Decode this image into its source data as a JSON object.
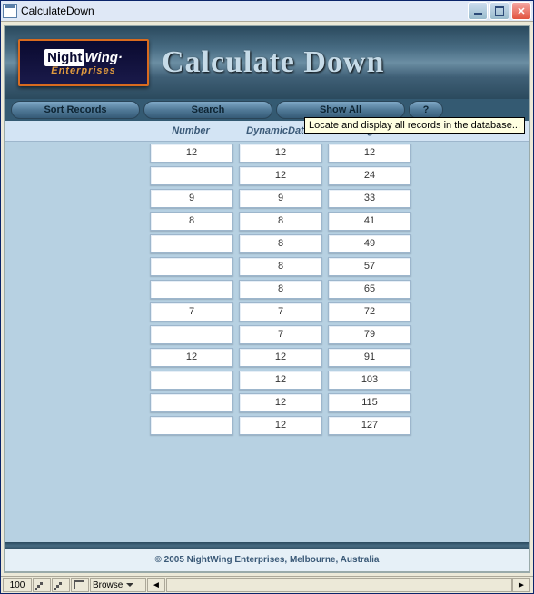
{
  "window": {
    "title": "CalculateDown"
  },
  "logo": {
    "part1": "Night",
    "part2": "Wing",
    "dot": "·",
    "sub": "Enterprises"
  },
  "banner": {
    "title": "Calculate Down"
  },
  "toolbar": {
    "sort": "Sort Records",
    "search": "Search",
    "showall": "Show All",
    "help": "?",
    "tooltip": "Locate and display all records in the database..."
  },
  "columns": {
    "number": "Number",
    "dynamic": "DynamicData",
    "running": "RunningTotal"
  },
  "rows": [
    {
      "n": "12",
      "d": "12",
      "r": "12"
    },
    {
      "n": "",
      "d": "12",
      "r": "24"
    },
    {
      "n": "9",
      "d": "9",
      "r": "33"
    },
    {
      "n": "8",
      "d": "8",
      "r": "41"
    },
    {
      "n": "",
      "d": "8",
      "r": "49"
    },
    {
      "n": "",
      "d": "8",
      "r": "57"
    },
    {
      "n": "",
      "d": "8",
      "r": "65"
    },
    {
      "n": "7",
      "d": "7",
      "r": "72"
    },
    {
      "n": "",
      "d": "7",
      "r": "79"
    },
    {
      "n": "12",
      "d": "12",
      "r": "91"
    },
    {
      "n": "",
      "d": "12",
      "r": "103"
    },
    {
      "n": "",
      "d": "12",
      "r": "115"
    },
    {
      "n": "",
      "d": "12",
      "r": "127"
    }
  ],
  "footer": {
    "copyright": "© 2005 NightWing Enterprises, Melbourne, Australia"
  },
  "status": {
    "zoom": "100",
    "mode": "Browse",
    "scroll_left": "◄",
    "scroll_right": "►"
  }
}
